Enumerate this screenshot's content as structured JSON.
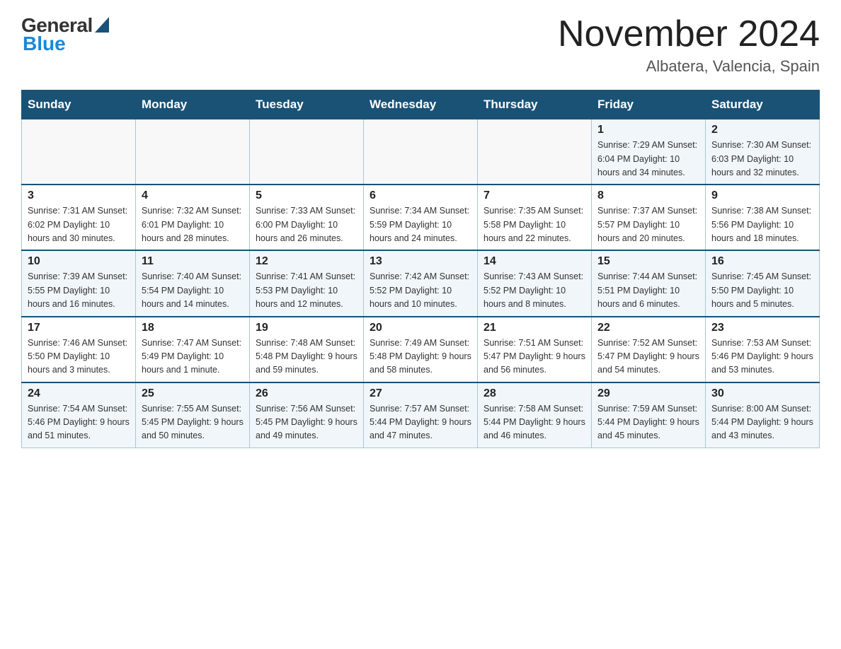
{
  "header": {
    "logo_general": "General",
    "logo_blue": "Blue",
    "month_title": "November 2024",
    "location": "Albatera, Valencia, Spain"
  },
  "days_of_week": [
    "Sunday",
    "Monday",
    "Tuesday",
    "Wednesday",
    "Thursday",
    "Friday",
    "Saturday"
  ],
  "weeks": [
    [
      {
        "day": "",
        "info": ""
      },
      {
        "day": "",
        "info": ""
      },
      {
        "day": "",
        "info": ""
      },
      {
        "day": "",
        "info": ""
      },
      {
        "day": "",
        "info": ""
      },
      {
        "day": "1",
        "info": "Sunrise: 7:29 AM\nSunset: 6:04 PM\nDaylight: 10 hours\nand 34 minutes."
      },
      {
        "day": "2",
        "info": "Sunrise: 7:30 AM\nSunset: 6:03 PM\nDaylight: 10 hours\nand 32 minutes."
      }
    ],
    [
      {
        "day": "3",
        "info": "Sunrise: 7:31 AM\nSunset: 6:02 PM\nDaylight: 10 hours\nand 30 minutes."
      },
      {
        "day": "4",
        "info": "Sunrise: 7:32 AM\nSunset: 6:01 PM\nDaylight: 10 hours\nand 28 minutes."
      },
      {
        "day": "5",
        "info": "Sunrise: 7:33 AM\nSunset: 6:00 PM\nDaylight: 10 hours\nand 26 minutes."
      },
      {
        "day": "6",
        "info": "Sunrise: 7:34 AM\nSunset: 5:59 PM\nDaylight: 10 hours\nand 24 minutes."
      },
      {
        "day": "7",
        "info": "Sunrise: 7:35 AM\nSunset: 5:58 PM\nDaylight: 10 hours\nand 22 minutes."
      },
      {
        "day": "8",
        "info": "Sunrise: 7:37 AM\nSunset: 5:57 PM\nDaylight: 10 hours\nand 20 minutes."
      },
      {
        "day": "9",
        "info": "Sunrise: 7:38 AM\nSunset: 5:56 PM\nDaylight: 10 hours\nand 18 minutes."
      }
    ],
    [
      {
        "day": "10",
        "info": "Sunrise: 7:39 AM\nSunset: 5:55 PM\nDaylight: 10 hours\nand 16 minutes."
      },
      {
        "day": "11",
        "info": "Sunrise: 7:40 AM\nSunset: 5:54 PM\nDaylight: 10 hours\nand 14 minutes."
      },
      {
        "day": "12",
        "info": "Sunrise: 7:41 AM\nSunset: 5:53 PM\nDaylight: 10 hours\nand 12 minutes."
      },
      {
        "day": "13",
        "info": "Sunrise: 7:42 AM\nSunset: 5:52 PM\nDaylight: 10 hours\nand 10 minutes."
      },
      {
        "day": "14",
        "info": "Sunrise: 7:43 AM\nSunset: 5:52 PM\nDaylight: 10 hours\nand 8 minutes."
      },
      {
        "day": "15",
        "info": "Sunrise: 7:44 AM\nSunset: 5:51 PM\nDaylight: 10 hours\nand 6 minutes."
      },
      {
        "day": "16",
        "info": "Sunrise: 7:45 AM\nSunset: 5:50 PM\nDaylight: 10 hours\nand 5 minutes."
      }
    ],
    [
      {
        "day": "17",
        "info": "Sunrise: 7:46 AM\nSunset: 5:50 PM\nDaylight: 10 hours\nand 3 minutes."
      },
      {
        "day": "18",
        "info": "Sunrise: 7:47 AM\nSunset: 5:49 PM\nDaylight: 10 hours\nand 1 minute."
      },
      {
        "day": "19",
        "info": "Sunrise: 7:48 AM\nSunset: 5:48 PM\nDaylight: 9 hours\nand 59 minutes."
      },
      {
        "day": "20",
        "info": "Sunrise: 7:49 AM\nSunset: 5:48 PM\nDaylight: 9 hours\nand 58 minutes."
      },
      {
        "day": "21",
        "info": "Sunrise: 7:51 AM\nSunset: 5:47 PM\nDaylight: 9 hours\nand 56 minutes."
      },
      {
        "day": "22",
        "info": "Sunrise: 7:52 AM\nSunset: 5:47 PM\nDaylight: 9 hours\nand 54 minutes."
      },
      {
        "day": "23",
        "info": "Sunrise: 7:53 AM\nSunset: 5:46 PM\nDaylight: 9 hours\nand 53 minutes."
      }
    ],
    [
      {
        "day": "24",
        "info": "Sunrise: 7:54 AM\nSunset: 5:46 PM\nDaylight: 9 hours\nand 51 minutes."
      },
      {
        "day": "25",
        "info": "Sunrise: 7:55 AM\nSunset: 5:45 PM\nDaylight: 9 hours\nand 50 minutes."
      },
      {
        "day": "26",
        "info": "Sunrise: 7:56 AM\nSunset: 5:45 PM\nDaylight: 9 hours\nand 49 minutes."
      },
      {
        "day": "27",
        "info": "Sunrise: 7:57 AM\nSunset: 5:44 PM\nDaylight: 9 hours\nand 47 minutes."
      },
      {
        "day": "28",
        "info": "Sunrise: 7:58 AM\nSunset: 5:44 PM\nDaylight: 9 hours\nand 46 minutes."
      },
      {
        "day": "29",
        "info": "Sunrise: 7:59 AM\nSunset: 5:44 PM\nDaylight: 9 hours\nand 45 minutes."
      },
      {
        "day": "30",
        "info": "Sunrise: 8:00 AM\nSunset: 5:44 PM\nDaylight: 9 hours\nand 43 minutes."
      }
    ]
  ]
}
